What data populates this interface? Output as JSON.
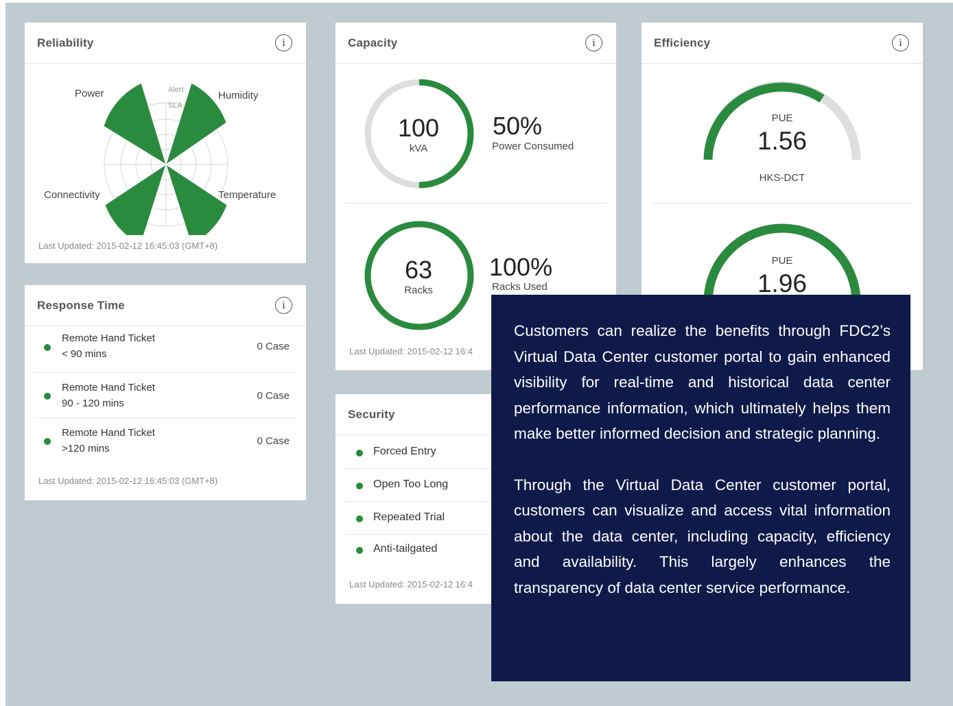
{
  "reliability": {
    "title": "Reliability",
    "info_icon": "info-icon",
    "labels": {
      "power": "Power",
      "humidity": "Humidity",
      "connectivity": "Connectivity",
      "temperature": "Temperature"
    },
    "center_labels": {
      "alert": "Alert",
      "sla": "SLA"
    },
    "updated": "Last Updated: 2015-02-12 16:45:03 (GMT+8)"
  },
  "response_time": {
    "title": "Response Time",
    "rows": [
      {
        "title": "Remote Hand Ticket",
        "range": "< 90 mins",
        "count": "0 Case"
      },
      {
        "title": "Remote Hand Ticket",
        "range": "90 - 120 mins",
        "count": "0 Case"
      },
      {
        "title": "Remote Hand Ticket",
        "range": ">120 mins",
        "count": "0 Case"
      }
    ],
    "updated": "Last Updated: 2015-02-12 16:45:03 (GMT+8)"
  },
  "capacity": {
    "title": "Capacity",
    "power": {
      "value": "100",
      "unit": "kVA",
      "percent": "50%",
      "caption": "Power Consumed",
      "fraction": 0.5
    },
    "racks": {
      "value": "63",
      "unit": "Racks",
      "percent": "100%",
      "caption": "Racks Used",
      "fraction": 1.0
    },
    "updated": "Last Updated: 2015-02-12 16:4"
  },
  "efficiency": {
    "title": "Efficiency",
    "gauges": [
      {
        "label": "PUE",
        "value": "1.56",
        "site": "HKS-DCT"
      },
      {
        "label": "PUE",
        "value": "1.96"
      }
    ]
  },
  "security": {
    "title": "Security",
    "items": [
      "Forced Entry",
      "Open Too Long",
      "Repeated Trial",
      "Anti-tailgated"
    ],
    "updated": "Last Updated: 2015-02-12 16:4"
  },
  "overlay": {
    "paragraph1": "Customers can realize the benefits through FDC2’s Virtual Data Center customer portal to gain enhanced visibility for real-time and historical data center performance information, which ultimately helps them make better informed decision and strategic planning.",
    "paragraph2": "Through the Virtual Data Center customer portal, customers can visualize and access vital information about the data center, including capacity, efficiency and availability. This largely enhances the transparency of data center service performance."
  },
  "colors": {
    "green": "#2a8a3e",
    "track": "#dedede",
    "background": "#bfcad1",
    "overlay": "#0f1a4a"
  }
}
